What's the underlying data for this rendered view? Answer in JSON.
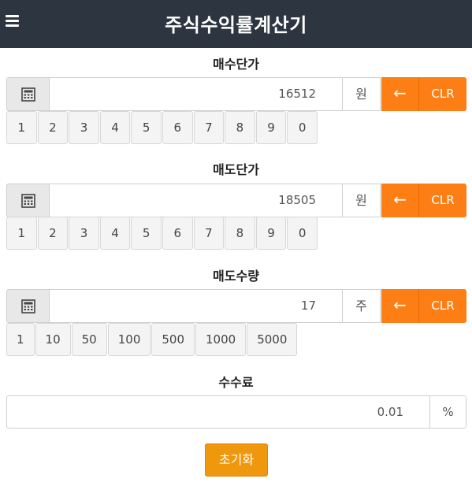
{
  "header": {
    "title": "주식수익률계산기",
    "menu_icon": "hamburger-menu-icon"
  },
  "buy_price": {
    "label": "매수단가",
    "value": "16512",
    "unit": "원",
    "back_label": "←",
    "clear_label": "CLR",
    "keys": [
      "1",
      "2",
      "3",
      "4",
      "5",
      "6",
      "7",
      "8",
      "9",
      "0"
    ]
  },
  "sell_price": {
    "label": "매도단가",
    "value": "18505",
    "unit": "원",
    "back_label": "←",
    "clear_label": "CLR",
    "keys": [
      "1",
      "2",
      "3",
      "4",
      "5",
      "6",
      "7",
      "8",
      "9",
      "0"
    ]
  },
  "sell_qty": {
    "label": "매도수량",
    "value": "17",
    "unit": "주",
    "back_label": "←",
    "clear_label": "CLR",
    "keys": [
      "1",
      "10",
      "50",
      "100",
      "500",
      "1000",
      "5000"
    ]
  },
  "fee": {
    "label": "수수료",
    "value": "0.01",
    "unit": "%"
  },
  "reset_label": "초기화",
  "colors": {
    "header_bg": "#2c3540",
    "accent": "#fd7e14",
    "reset": "#f0980d"
  }
}
